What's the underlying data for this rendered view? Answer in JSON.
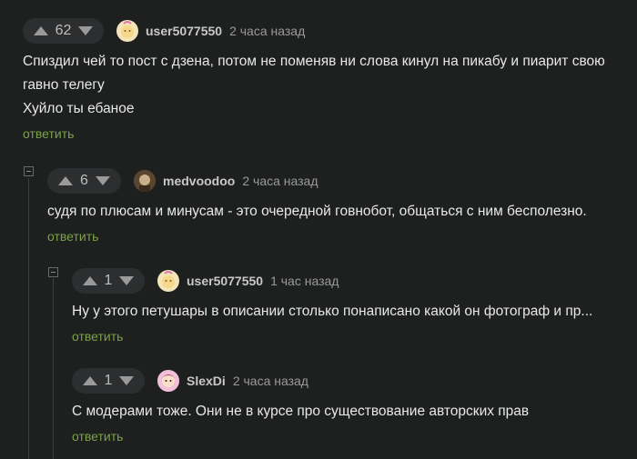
{
  "comments": [
    {
      "rating": "62",
      "user": "user5077550",
      "time": "2 часа назад",
      "text_lines": [
        "Спиздил чей то пост с дзена, потом не поменяв ни слова кинул на пикабу и пиарит свою",
        "гавно телегу",
        "Хуйло ты ебаное"
      ],
      "reply": "ответить",
      "avatar_bg": "#f3e5b8"
    },
    {
      "rating": "6",
      "user": "medvoodoo",
      "time": "2 часа назад",
      "text_lines": [
        "судя по плюсам и минусам - это очередной говнобот, общаться с ним бесполезно."
      ],
      "reply": "ответить",
      "avatar_bg": "#6b5a3e"
    },
    {
      "rating": "1",
      "user": "user5077550",
      "time": "1 час назад",
      "text_lines": [
        "Ну у этого петушары в описании столько понаписано какой он фотограф и пр..."
      ],
      "reply": "ответить",
      "avatar_bg": "#f3e5b8"
    },
    {
      "rating": "1",
      "user": "SlexDi",
      "time": "2 часа назад",
      "text_lines": [
        "С модерами тоже. Они не в курсе про существование авторских прав"
      ],
      "reply": "ответить",
      "avatar_bg": "#d86aa0"
    }
  ]
}
